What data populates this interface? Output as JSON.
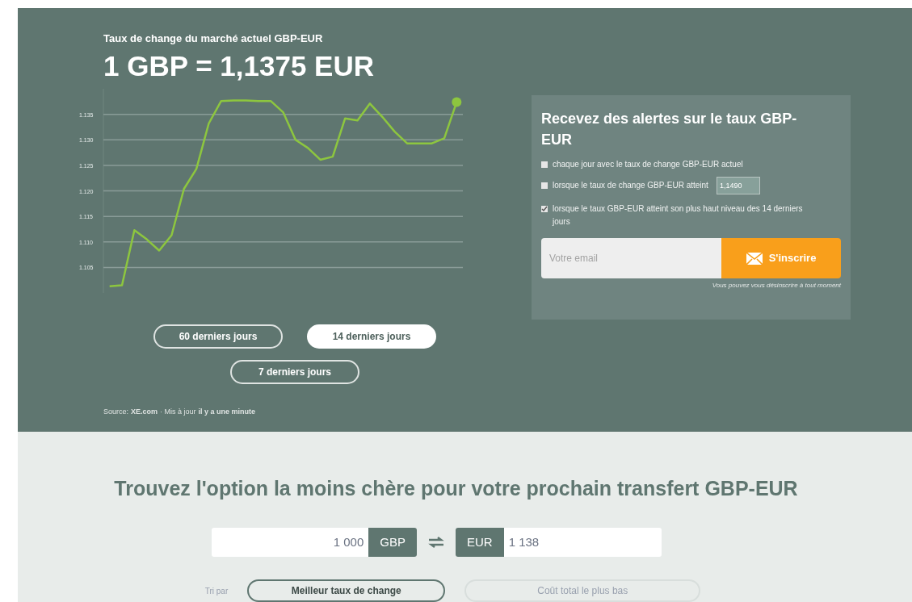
{
  "rate_panel": {
    "title": "Taux de change du marché actuel GBP-EUR",
    "rate": "1 GBP = 1,1375 EUR",
    "chart_data": {
      "type": "line",
      "categories": [
        null,
        null,
        null,
        null,
        null,
        null,
        null,
        null,
        null,
        null,
        null,
        null,
        null,
        null,
        null,
        null,
        null,
        null,
        null,
        null,
        null,
        null,
        null,
        null,
        null,
        null,
        null,
        null,
        null
      ],
      "series": [
        {
          "color": "#8dc63f",
          "values": [
            1.1013,
            1.1015,
            1.1123,
            1.1105,
            1.1083,
            1.1113,
            1.1204,
            1.1243,
            1.1332,
            1.1376,
            1.1377,
            1.1377,
            1.1376,
            1.1376,
            1.1354,
            1.13,
            1.1284,
            1.1261,
            1.1267,
            1.1342,
            1.1338,
            1.1371,
            1.1345,
            1.1316,
            1.1293,
            1.1293,
            1.1293,
            1.1303,
            1.1374
          ]
        }
      ],
      "grid": true,
      "ylim": [
        1.1,
        1.14
      ],
      "yticks": [
        {
          "value": 1.135,
          "label": "1.135"
        },
        {
          "value": 1.13,
          "label": "1.130"
        },
        {
          "value": 1.125,
          "label": "1.125"
        },
        {
          "value": 1.12,
          "label": "1.120"
        },
        {
          "value": 1.115,
          "label": "1.115"
        },
        {
          "value": 1.11,
          "label": "1.110"
        },
        {
          "value": 1.105,
          "label": "1.105"
        }
      ]
    },
    "ranges": [
      {
        "label": "60 derniers jours",
        "selected": false
      },
      {
        "label": "14 derniers jours",
        "selected": true
      },
      {
        "label": "7 derniers jours",
        "selected": false
      }
    ],
    "source": {
      "label": "Source:",
      "site": "XE.com",
      "updated": "· Mis à jour",
      "when": "il y a une minute"
    }
  },
  "alerts": {
    "title": "Recevez des alertes sur le taux GBP-EUR",
    "options": [
      {
        "label": "chaque jour avec le taux de change GBP-EUR actuel",
        "checked": false
      },
      {
        "label": "lorsque le taux de change GBP-EUR atteint",
        "checked": false,
        "threshold": "1,1490"
      },
      {
        "label": "lorsque le taux GBP-EUR atteint son plus haut niveau des 14 derniers jours",
        "checked": true
      }
    ],
    "email_placeholder": "Votre email",
    "subscribe": "S'inscrire",
    "note": "Vous pouvez vous désinscrire à tout moment"
  },
  "compare": {
    "title": "Trouvez l'option la moins chère pour votre prochain transfert GBP-EUR",
    "send_amount": "1 000",
    "send_currency": "GBP",
    "receive_currency": "EUR",
    "receive_amount": "1 138",
    "sort_label": "Tri par",
    "sort_options": [
      {
        "label": "Meilleur taux de change",
        "selected": true
      },
      {
        "label": "Coût total le plus bas",
        "selected": false
      }
    ]
  }
}
